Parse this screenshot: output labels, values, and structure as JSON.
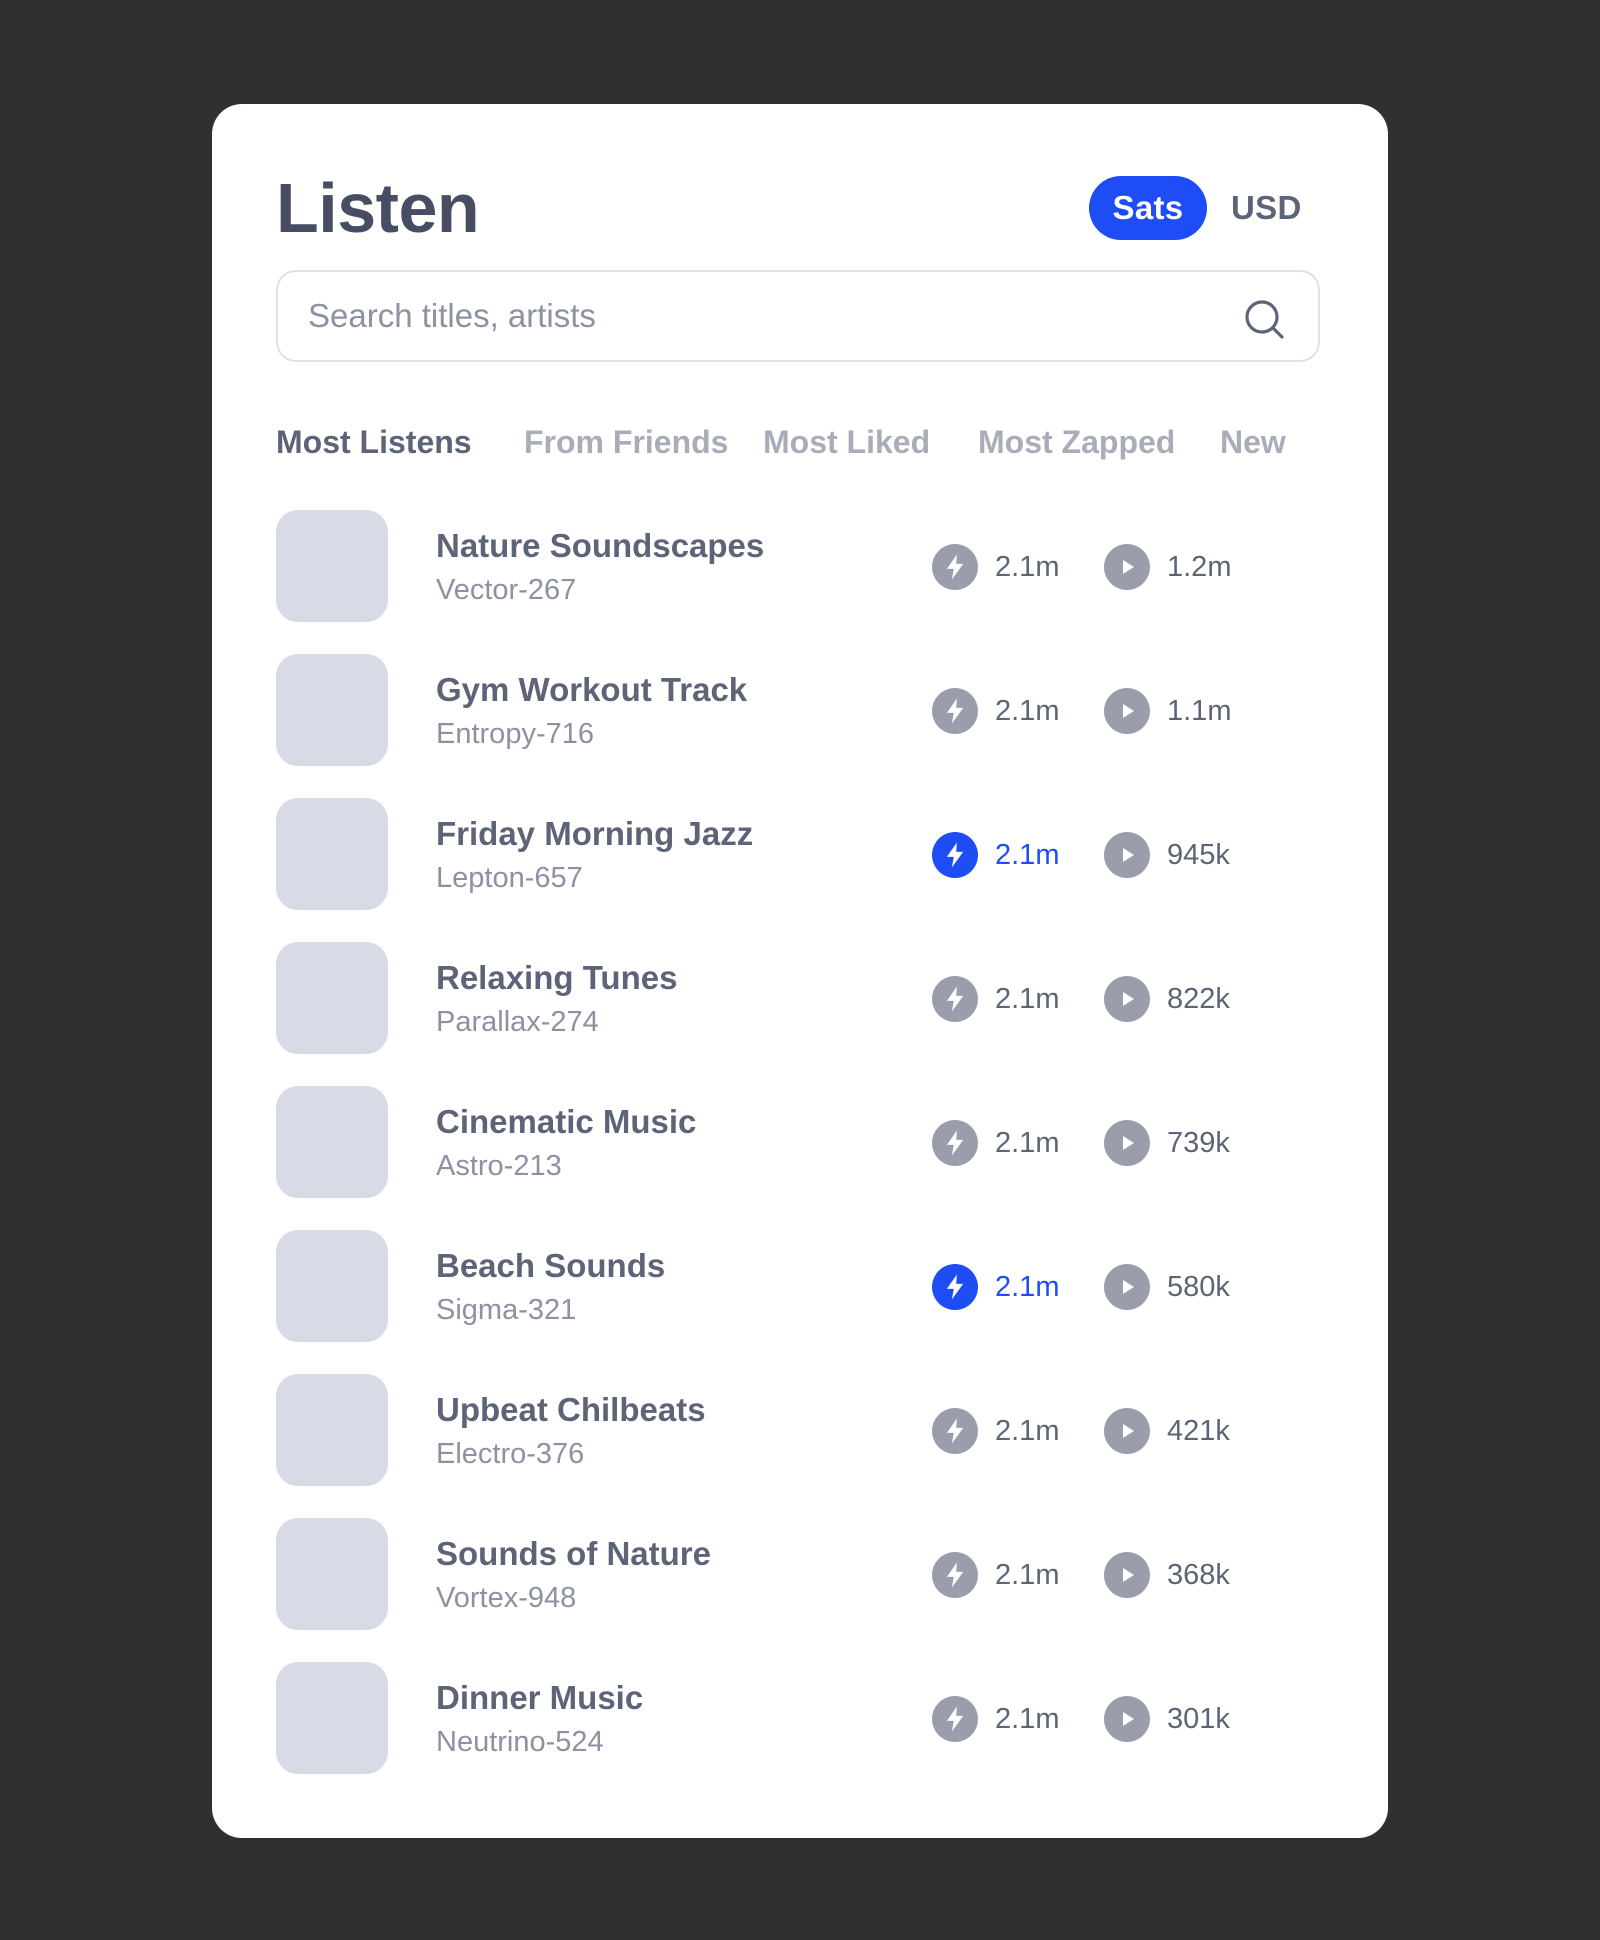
{
  "header": {
    "title": "Listen"
  },
  "currency": {
    "options": [
      "Sats",
      "USD"
    ],
    "selected": "Sats"
  },
  "search": {
    "placeholder": "Search titles, artists",
    "value": ""
  },
  "tabs": [
    {
      "label": "Most Listens",
      "active": true
    },
    {
      "label": "From Friends",
      "active": false
    },
    {
      "label": "Most Liked",
      "active": false
    },
    {
      "label": "Most Zapped",
      "active": false
    },
    {
      "label": "New",
      "active": false
    }
  ],
  "tracks": [
    {
      "title": "Nature Soundscapes",
      "artist": "Vector-267",
      "zaps": "2.1m",
      "plays": "1.2m",
      "zapped": false
    },
    {
      "title": "Gym Workout Track",
      "artist": "Entropy-716",
      "zaps": "2.1m",
      "plays": "1.1m",
      "zapped": false
    },
    {
      "title": "Friday Morning Jazz",
      "artist": "Lepton-657",
      "zaps": "2.1m",
      "plays": "945k",
      "zapped": true
    },
    {
      "title": "Relaxing Tunes",
      "artist": "Parallax-274",
      "zaps": "2.1m",
      "plays": "822k",
      "zapped": false
    },
    {
      "title": "Cinematic Music",
      "artist": "Astro-213",
      "zaps": "2.1m",
      "plays": "739k",
      "zapped": false
    },
    {
      "title": "Beach Sounds",
      "artist": "Sigma-321",
      "zaps": "2.1m",
      "plays": "580k",
      "zapped": true
    },
    {
      "title": "Upbeat Chilbeats",
      "artist": "Electro-376",
      "zaps": "2.1m",
      "plays": "421k",
      "zapped": false
    },
    {
      "title": "Sounds of Nature",
      "artist": "Vortex-948",
      "zaps": "2.1m",
      "plays": "368k",
      "zapped": false
    },
    {
      "title": "Dinner Music",
      "artist": "Neutrino-524",
      "zaps": "2.1m",
      "plays": "301k",
      "zapped": false
    }
  ],
  "colors": {
    "accent": "#1e4df5",
    "icon_inactive": "#9a9eab",
    "thumbnail": "#d8dae5"
  },
  "icons": {
    "zap": "lightning-bolt-icon",
    "play": "play-icon",
    "search": "search-icon"
  }
}
